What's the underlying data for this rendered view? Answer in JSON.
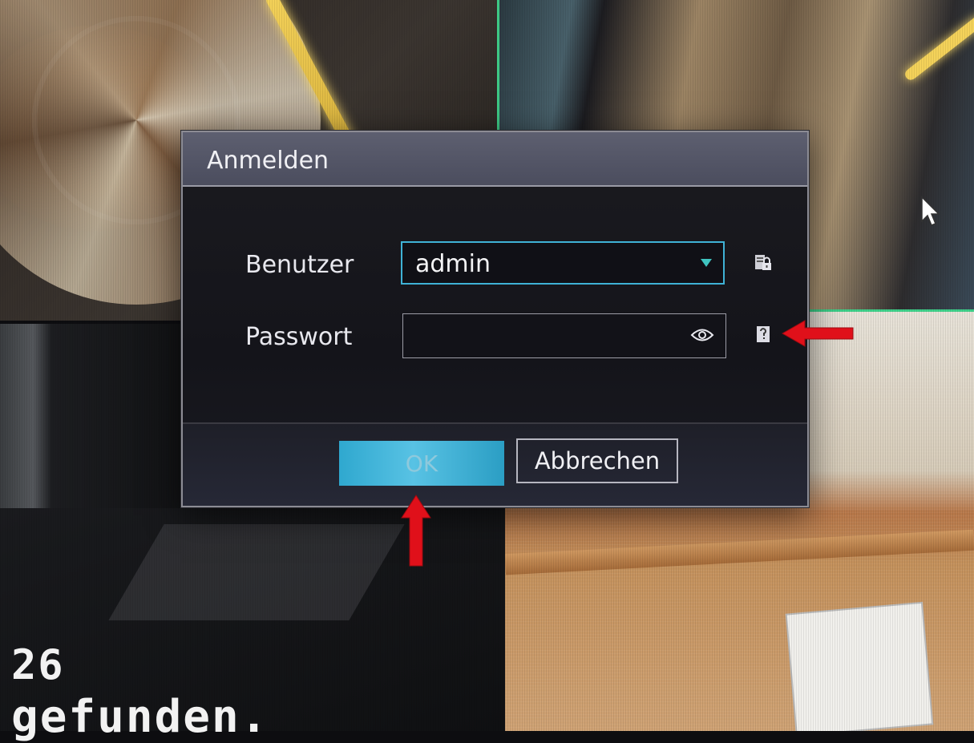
{
  "dialog": {
    "title": "Anmelden",
    "user_label": "Benutzer",
    "user_value": "admin",
    "password_label": "Passwort",
    "password_value": "",
    "ok_label": "OK",
    "cancel_label": "Abbrechen"
  },
  "osd": {
    "line1": "26",
    "line2": "gefunden."
  },
  "colors": {
    "accent": "#3fb2d6",
    "ok_button": "#3fb7dd",
    "annotation_arrow": "#e0101a"
  },
  "icons": {
    "user_dropdown": "triangle-down-icon",
    "password_toggle": "eye-icon",
    "user_side": "user-lock-icon",
    "password_help": "password-hint-icon"
  }
}
